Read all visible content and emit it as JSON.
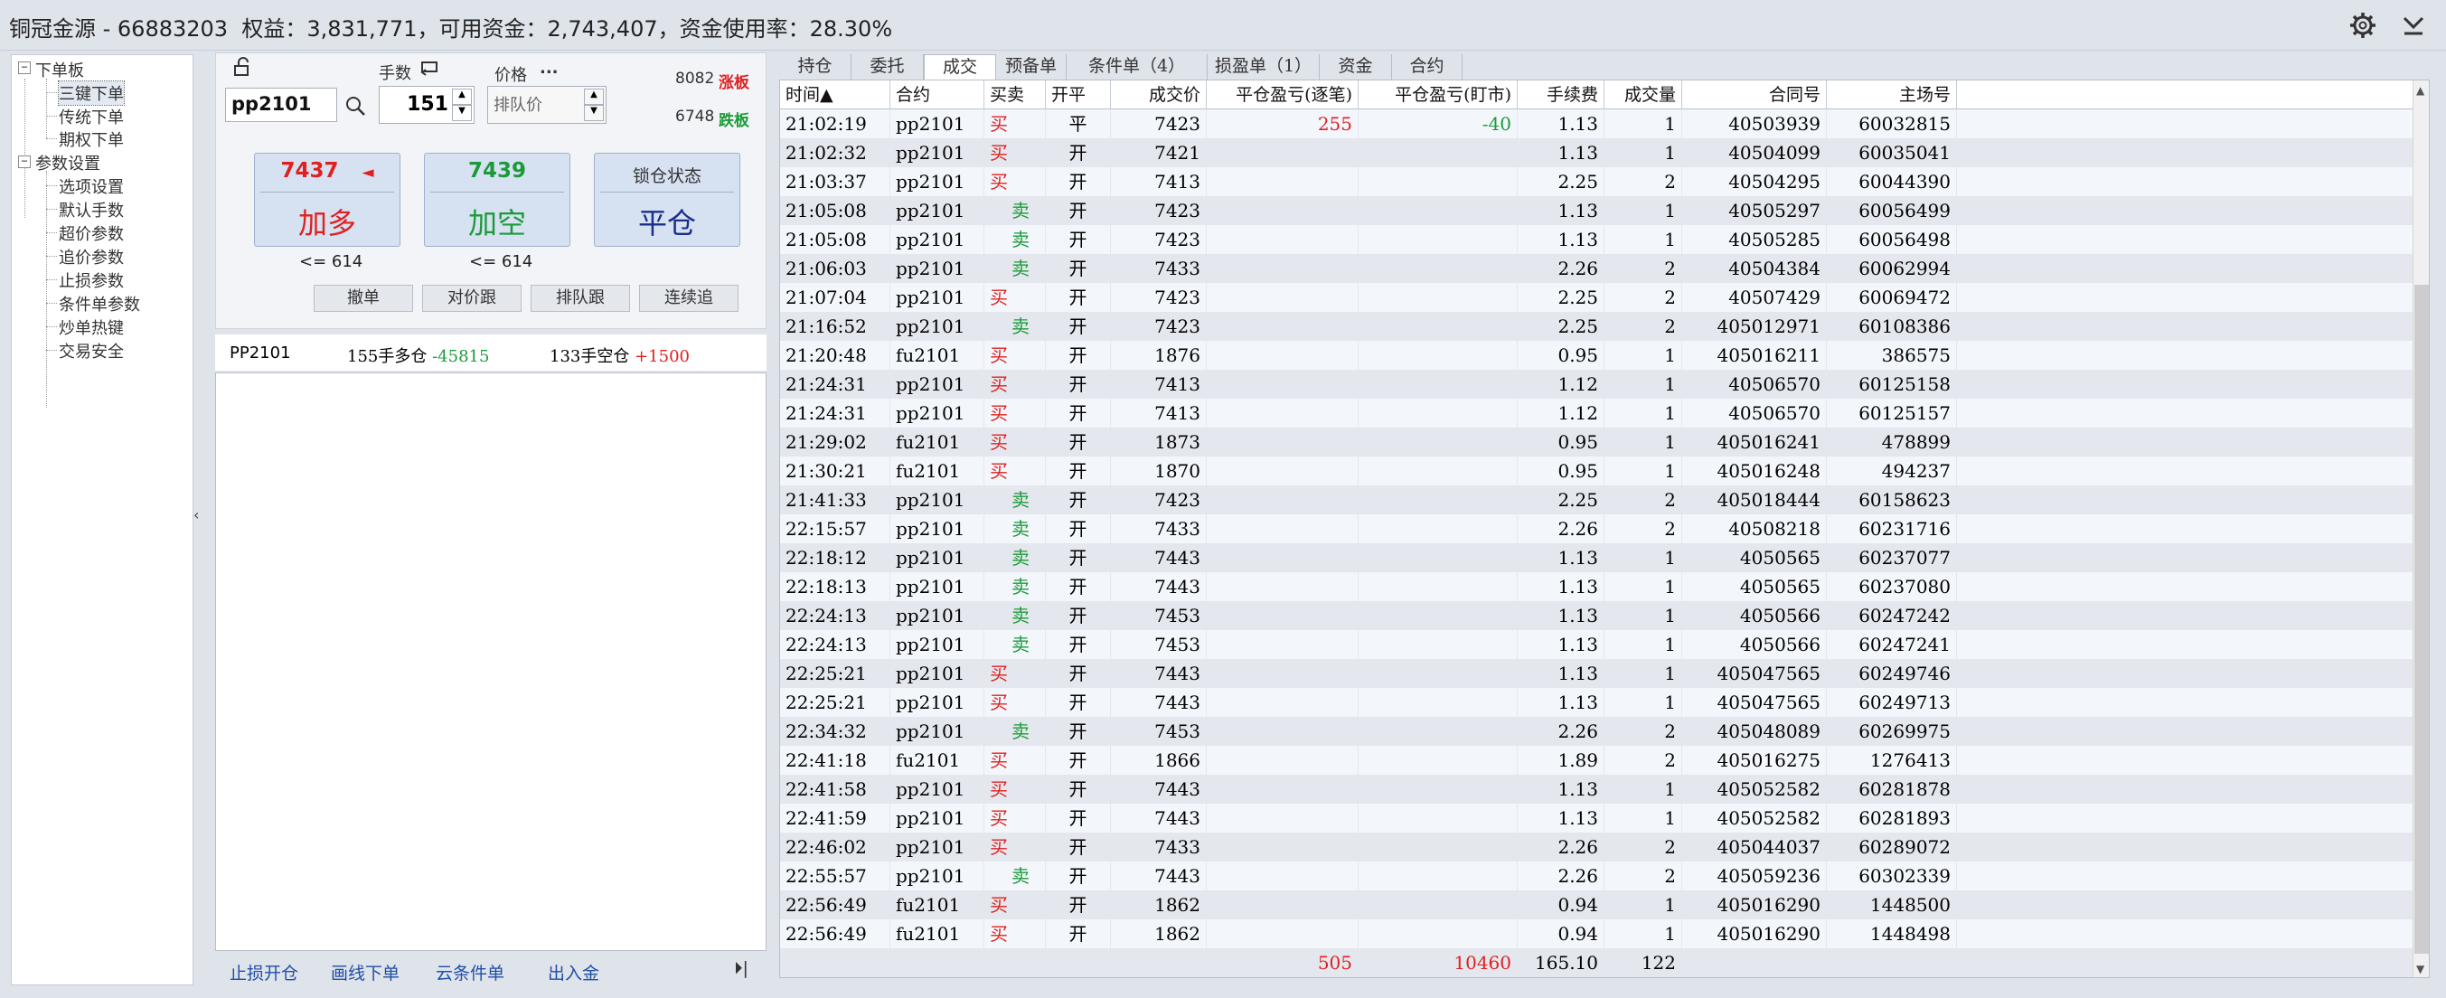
{
  "title_bar": {
    "text": "铜冠金源 - 66883203  权益：3,831,771，可用资金：2,743,407，资金使用率：28.30%"
  },
  "tree": {
    "groups": [
      {
        "label": "下单板",
        "items": [
          "三键下单",
          "传统下单",
          "期权下单"
        ]
      },
      {
        "label": "参数设置",
        "items": [
          "选项设置",
          "默认手数",
          "超价参数",
          "追价参数",
          "止损参数",
          "条件单参数",
          "炒单热键",
          "交易安全"
        ]
      }
    ]
  },
  "order": {
    "lots_label": "手数",
    "price_label": "价格",
    "price_dots": "...",
    "contract": "pp2101",
    "lots": "151",
    "price_type": "排队价",
    "limit_up_val": "8082",
    "limit_up_label": "涨板",
    "limit_down_val": "6748",
    "limit_down_label": "跌板",
    "buy": {
      "price": "7437",
      "arrow": "◄",
      "label": "加多",
      "limit": "<= 614"
    },
    "sell": {
      "price": "7439",
      "label": "加空",
      "limit": "<= 614"
    },
    "close": {
      "status": "锁仓状态",
      "label": "平仓"
    },
    "buttons": [
      "撤单",
      "对价跟",
      "排队跟",
      "连续追"
    ]
  },
  "summary": {
    "contract": "PP2101",
    "long_lots": "155",
    "long_label": "手多仓",
    "long_pnl": "-45815",
    "short_lots": "133",
    "short_label": "手空仓",
    "short_pnl": "+1500"
  },
  "bottom_links": [
    "止损开仓",
    "画线下单",
    "云条件单",
    "出入金"
  ],
  "expand_icon": "⏵|",
  "tabs": [
    "持仓",
    "委托",
    "成交",
    "预备单",
    "条件单（4）",
    "损盈单（1）",
    "资金",
    "合约"
  ],
  "active_tab": "成交",
  "columns": [
    "时间▲",
    "合约",
    "买卖",
    "开平",
    "成交价",
    "平仓盈亏(逐笔)",
    "平仓盈亏(盯市)",
    "手续费",
    "成交量",
    "合同号",
    "主场号"
  ],
  "rows": [
    [
      "21:02:19",
      "pp2101",
      "买",
      "平",
      "7423",
      "255",
      "-40",
      "1.13",
      "1",
      "40503939",
      "60032815"
    ],
    [
      "21:02:32",
      "pp2101",
      "买",
      "开",
      "7421",
      "",
      "",
      "1.13",
      "1",
      "40504099",
      "60035041"
    ],
    [
      "21:03:37",
      "pp2101",
      "买",
      "开",
      "7413",
      "",
      "",
      "2.25",
      "2",
      "40504295",
      "60044390"
    ],
    [
      "21:05:08",
      "pp2101",
      "卖",
      "开",
      "7423",
      "",
      "",
      "1.13",
      "1",
      "40505297",
      "60056499"
    ],
    [
      "21:05:08",
      "pp2101",
      "卖",
      "开",
      "7423",
      "",
      "",
      "1.13",
      "1",
      "40505285",
      "60056498"
    ],
    [
      "21:06:03",
      "pp2101",
      "卖",
      "开",
      "7433",
      "",
      "",
      "2.26",
      "2",
      "40504384",
      "60062994"
    ],
    [
      "21:07:04",
      "pp2101",
      "买",
      "开",
      "7423",
      "",
      "",
      "2.25",
      "2",
      "40507429",
      "60069472"
    ],
    [
      "21:16:52",
      "pp2101",
      "卖",
      "开",
      "7423",
      "",
      "",
      "2.25",
      "2",
      "405012971",
      "60108386"
    ],
    [
      "21:20:48",
      "fu2101",
      "买",
      "开",
      "1876",
      "",
      "",
      "0.95",
      "1",
      "405016211",
      "386575"
    ],
    [
      "21:24:31",
      "pp2101",
      "买",
      "开",
      "7413",
      "",
      "",
      "1.12",
      "1",
      "40506570",
      "60125158"
    ],
    [
      "21:24:31",
      "pp2101",
      "买",
      "开",
      "7413",
      "",
      "",
      "1.12",
      "1",
      "40506570",
      "60125157"
    ],
    [
      "21:29:02",
      "fu2101",
      "买",
      "开",
      "1873",
      "",
      "",
      "0.95",
      "1",
      "405016241",
      "478899"
    ],
    [
      "21:30:21",
      "fu2101",
      "买",
      "开",
      "1870",
      "",
      "",
      "0.95",
      "1",
      "405016248",
      "494237"
    ],
    [
      "21:41:33",
      "pp2101",
      "卖",
      "开",
      "7423",
      "",
      "",
      "2.25",
      "2",
      "405018444",
      "60158623"
    ],
    [
      "22:15:57",
      "pp2101",
      "卖",
      "开",
      "7433",
      "",
      "",
      "2.26",
      "2",
      "40508218",
      "60231716"
    ],
    [
      "22:18:12",
      "pp2101",
      "卖",
      "开",
      "7443",
      "",
      "",
      "1.13",
      "1",
      "4050565",
      "60237077"
    ],
    [
      "22:18:13",
      "pp2101",
      "卖",
      "开",
      "7443",
      "",
      "",
      "1.13",
      "1",
      "4050565",
      "60237080"
    ],
    [
      "22:24:13",
      "pp2101",
      "卖",
      "开",
      "7453",
      "",
      "",
      "1.13",
      "1",
      "4050566",
      "60247242"
    ],
    [
      "22:24:13",
      "pp2101",
      "卖",
      "开",
      "7453",
      "",
      "",
      "1.13",
      "1",
      "4050566",
      "60247241"
    ],
    [
      "22:25:21",
      "pp2101",
      "买",
      "开",
      "7443",
      "",
      "",
      "1.13",
      "1",
      "405047565",
      "60249746"
    ],
    [
      "22:25:21",
      "pp2101",
      "买",
      "开",
      "7443",
      "",
      "",
      "1.13",
      "1",
      "405047565",
      "60249713"
    ],
    [
      "22:34:32",
      "pp2101",
      "卖",
      "开",
      "7453",
      "",
      "",
      "2.26",
      "2",
      "405048089",
      "60269975"
    ],
    [
      "22:41:18",
      "fu2101",
      "买",
      "开",
      "1866",
      "",
      "",
      "1.89",
      "2",
      "405016275",
      "1276413"
    ],
    [
      "22:41:58",
      "pp2101",
      "买",
      "开",
      "7443",
      "",
      "",
      "1.13",
      "1",
      "405052582",
      "60281878"
    ],
    [
      "22:41:59",
      "pp2101",
      "买",
      "开",
      "7443",
      "",
      "",
      "1.13",
      "1",
      "405052582",
      "60281893"
    ],
    [
      "22:46:02",
      "pp2101",
      "买",
      "开",
      "7433",
      "",
      "",
      "2.26",
      "2",
      "405044037",
      "60289072"
    ],
    [
      "22:55:57",
      "pp2101",
      "卖",
      "开",
      "7443",
      "",
      "",
      "2.26",
      "2",
      "405059236",
      "60302339"
    ],
    [
      "22:56:49",
      "fu2101",
      "买",
      "开",
      "1862",
      "",
      "",
      "0.94",
      "1",
      "405016290",
      "1448500"
    ],
    [
      "22:56:49",
      "fu2101",
      "买",
      "开",
      "1862",
      "",
      "",
      "0.94",
      "1",
      "405016290",
      "1448498"
    ]
  ],
  "totals": [
    "",
    "",
    "",
    "",
    "",
    "505",
    "10460",
    "165.10",
    "122",
    "",
    ""
  ],
  "colors": {
    "buy": "#e02020",
    "sell": "#1c9a3a",
    "row_alt": "#e4e8ee",
    "row_base": "#f3f7fc"
  }
}
